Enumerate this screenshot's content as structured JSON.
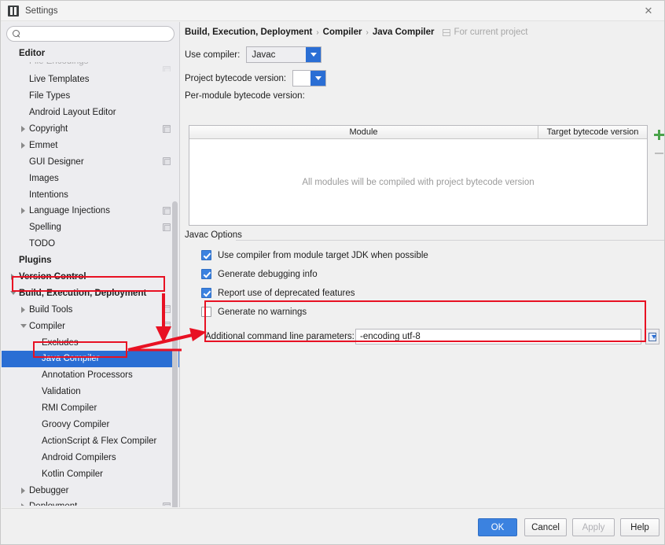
{
  "window": {
    "title": "Settings",
    "app_icon": "intellij-idea-icon",
    "close_label": "✕"
  },
  "sidebar": {
    "search": {
      "value": "",
      "placeholder": "",
      "icon": "search-icon"
    },
    "items": [
      {
        "label": "Editor",
        "level": 0,
        "bold": true,
        "arrow": "none",
        "side_icon": false,
        "cutoff": false,
        "selected": false
      },
      {
        "label": "File Encodings",
        "level": 1,
        "bold": false,
        "arrow": "none",
        "side_icon": true,
        "cutoff": true,
        "selected": false
      },
      {
        "label": "Live Templates",
        "level": 1,
        "bold": false,
        "arrow": "none",
        "side_icon": false,
        "cutoff": false,
        "selected": false
      },
      {
        "label": "File Types",
        "level": 1,
        "bold": false,
        "arrow": "none",
        "side_icon": false,
        "cutoff": false,
        "selected": false
      },
      {
        "label": "Android Layout Editor",
        "level": 1,
        "bold": false,
        "arrow": "none",
        "side_icon": false,
        "cutoff": false,
        "selected": false
      },
      {
        "label": "Copyright",
        "level": 1,
        "bold": false,
        "arrow": "collapsed",
        "side_icon": true,
        "cutoff": false,
        "selected": false
      },
      {
        "label": "Emmet",
        "level": 1,
        "bold": false,
        "arrow": "collapsed",
        "side_icon": false,
        "cutoff": false,
        "selected": false
      },
      {
        "label": "GUI Designer",
        "level": 1,
        "bold": false,
        "arrow": "none",
        "side_icon": true,
        "cutoff": false,
        "selected": false
      },
      {
        "label": "Images",
        "level": 1,
        "bold": false,
        "arrow": "none",
        "side_icon": false,
        "cutoff": false,
        "selected": false
      },
      {
        "label": "Intentions",
        "level": 1,
        "bold": false,
        "arrow": "none",
        "side_icon": false,
        "cutoff": false,
        "selected": false
      },
      {
        "label": "Language Injections",
        "level": 1,
        "bold": false,
        "arrow": "collapsed",
        "side_icon": true,
        "cutoff": false,
        "selected": false
      },
      {
        "label": "Spelling",
        "level": 1,
        "bold": false,
        "arrow": "none",
        "side_icon": true,
        "cutoff": false,
        "selected": false
      },
      {
        "label": "TODO",
        "level": 1,
        "bold": false,
        "arrow": "none",
        "side_icon": false,
        "cutoff": false,
        "selected": false
      },
      {
        "label": "Plugins",
        "level": 0,
        "bold": true,
        "arrow": "none",
        "side_icon": false,
        "cutoff": false,
        "selected": false
      },
      {
        "label": "Version Control",
        "level": 0,
        "bold": true,
        "arrow": "collapsed",
        "side_icon": false,
        "cutoff": false,
        "selected": false
      },
      {
        "label": "Build, Execution, Deployment",
        "level": 0,
        "bold": true,
        "arrow": "expanded",
        "side_icon": false,
        "cutoff": false,
        "selected": false
      },
      {
        "label": "Build Tools",
        "level": 1,
        "bold": false,
        "arrow": "collapsed",
        "side_icon": true,
        "cutoff": false,
        "selected": false
      },
      {
        "label": "Compiler",
        "level": 1,
        "bold": false,
        "arrow": "expanded",
        "side_icon": true,
        "cutoff": false,
        "selected": false
      },
      {
        "label": "Excludes",
        "level": 2,
        "bold": false,
        "arrow": "none",
        "side_icon": false,
        "cutoff": false,
        "selected": false
      },
      {
        "label": "Java Compiler",
        "level": 2,
        "bold": false,
        "arrow": "none",
        "side_icon": false,
        "cutoff": false,
        "selected": true
      },
      {
        "label": "Annotation Processors",
        "level": 2,
        "bold": false,
        "arrow": "none",
        "side_icon": false,
        "cutoff": false,
        "selected": false
      },
      {
        "label": "Validation",
        "level": 2,
        "bold": false,
        "arrow": "none",
        "side_icon": false,
        "cutoff": false,
        "selected": false
      },
      {
        "label": "RMI Compiler",
        "level": 2,
        "bold": false,
        "arrow": "none",
        "side_icon": false,
        "cutoff": false,
        "selected": false
      },
      {
        "label": "Groovy Compiler",
        "level": 2,
        "bold": false,
        "arrow": "none",
        "side_icon": false,
        "cutoff": false,
        "selected": false
      },
      {
        "label": "ActionScript & Flex Compiler",
        "level": 2,
        "bold": false,
        "arrow": "none",
        "side_icon": false,
        "cutoff": false,
        "selected": false
      },
      {
        "label": "Android Compilers",
        "level": 2,
        "bold": false,
        "arrow": "none",
        "side_icon": false,
        "cutoff": false,
        "selected": false
      },
      {
        "label": "Kotlin Compiler",
        "level": 2,
        "bold": false,
        "arrow": "none",
        "side_icon": false,
        "cutoff": false,
        "selected": false
      },
      {
        "label": "Debugger",
        "level": 1,
        "bold": false,
        "arrow": "collapsed",
        "side_icon": false,
        "cutoff": false,
        "selected": false
      },
      {
        "label": "Deployment",
        "level": 1,
        "bold": false,
        "arrow": "collapsed",
        "side_icon": true,
        "cutoff": false,
        "selected": false
      }
    ]
  },
  "breadcrumb": {
    "crumbs": [
      "Build, Execution, Deployment",
      "Compiler",
      "Java Compiler"
    ],
    "separator": "›",
    "scope_label": "For current project",
    "scope_icon": "project-scope-icon"
  },
  "main": {
    "use_compiler_label": "Use compiler:",
    "use_compiler_value": "Javac",
    "project_bytecode_label": "Project bytecode version:",
    "project_bytecode_value": "",
    "per_module_label": "Per-module bytecode version:",
    "table": {
      "columns": [
        "Module",
        "Target bytecode version"
      ],
      "rows": [],
      "empty_text": "All modules will be compiled with project bytecode version",
      "add_button": "add-row-button",
      "remove_button": "remove-row-button"
    },
    "javac_group_label": "Javac Options",
    "options": [
      {
        "label": "Use compiler from module target JDK when possible",
        "checked": true
      },
      {
        "label": "Generate debugging info",
        "checked": true
      },
      {
        "label": "Report use of deprecated features",
        "checked": true
      },
      {
        "label": "Generate no warnings",
        "checked": false
      }
    ],
    "additional_params_label": "Additional command line parameters:",
    "additional_params_value": "-encoding utf-8",
    "additional_params_button": "expand-editor-button"
  },
  "buttons": {
    "ok": "OK",
    "cancel": "Cancel",
    "apply": "Apply",
    "help": "Help"
  },
  "annotations": {
    "accent_color": "#e81123",
    "highlight_color": "#2a6ed4",
    "boxes": [
      "build-execution-deployment-row",
      "java-compiler-row",
      "additional-params-field"
    ],
    "arrows": 2
  }
}
